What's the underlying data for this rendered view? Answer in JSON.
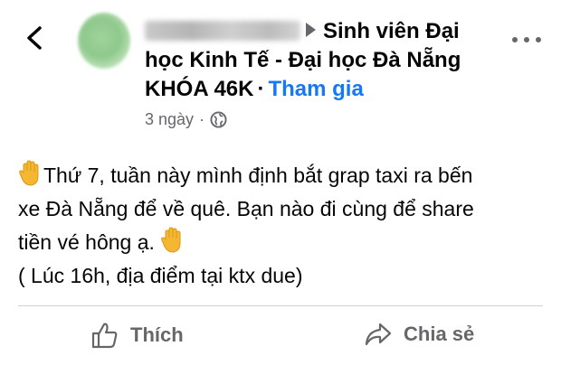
{
  "nav": {
    "back_icon": "chevron-left-icon",
    "more_icon": "more-horizontal-icon"
  },
  "header": {
    "group_name_line1": "Sinh viên Đại",
    "group_name_line2": "học Kinh Tế - Đại học Đà Nẵng",
    "group_name_line3": "KHÓA 46K",
    "separator": "·",
    "join_label": "Tham gia",
    "time_ago": "3 ngày",
    "meta_separator": "·",
    "privacy_icon": "globe-icon"
  },
  "post": {
    "line1": "Thứ 7, tuần này mình định bắt grap taxi ra bến",
    "line2": "xe Đà Nẵng để về quê. Bạn nào đi cùng để share",
    "line3": "tiền vé hông ạ.",
    "line4": "( Lúc 16h, địa điểm tại ktx due)",
    "emoji_icon": "waving-hand-icon"
  },
  "actions": {
    "like_label": "Thích",
    "like_icon": "thumbs-up-icon",
    "share_label": "Chia sẻ",
    "share_icon": "share-arrow-icon"
  },
  "colors": {
    "link": "#1877f2",
    "secondary_text": "#65676b",
    "text": "#050505",
    "divider": "#ced0d4"
  }
}
